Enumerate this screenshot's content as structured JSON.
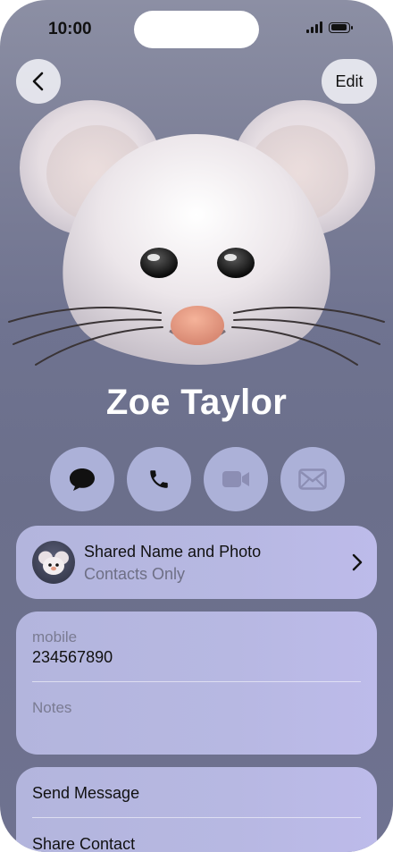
{
  "status_bar": {
    "time": "10:00"
  },
  "nav": {
    "edit_label": "Edit"
  },
  "contact": {
    "name": "Zoe Taylor"
  },
  "actions": [
    {
      "name": "message",
      "icon": "message-bubble-icon"
    },
    {
      "name": "call",
      "icon": "phone-icon"
    },
    {
      "name": "video",
      "icon": "video-icon"
    },
    {
      "name": "mail",
      "icon": "mail-icon"
    }
  ],
  "shared": {
    "title": "Shared Name and Photo",
    "subtitle": "Contacts Only"
  },
  "fields": {
    "mobile_label": "mobile",
    "mobile_value": "234567890",
    "notes_label": "Notes"
  },
  "menu": {
    "send_message": "Send Message",
    "share_contact": "Share Contact"
  },
  "colors": {
    "background": "#6f7390",
    "card": "#b7b8e2",
    "action_button": "#b0b4dc"
  }
}
